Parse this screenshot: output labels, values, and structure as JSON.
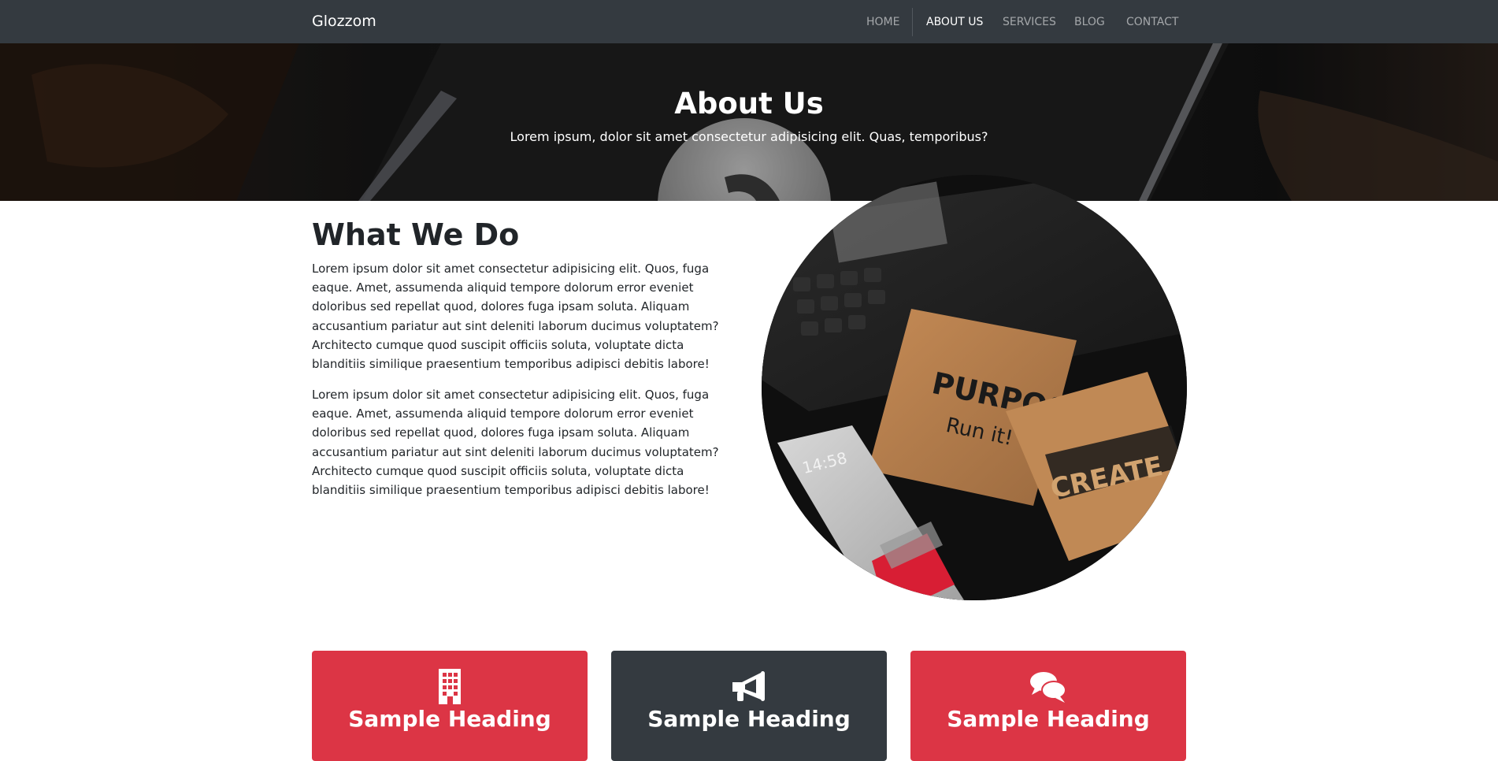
{
  "navbar": {
    "brand": "Glozzom",
    "links": [
      {
        "label": "HOME",
        "active": false
      },
      {
        "label": "ABOUT US",
        "active": true
      },
      {
        "label": "SERVICES",
        "active": false
      },
      {
        "label": "BLOG",
        "active": false
      },
      {
        "label": "CONTACT",
        "active": false
      }
    ]
  },
  "hero": {
    "title": "About Us",
    "subtitle": "Lorem ipsum, dolor sit amet consectetur adipisicing elit. Quas, temporibus?"
  },
  "about": {
    "heading": "What We Do",
    "paragraphs": [
      "Lorem ipsum dolor sit amet consectetur adipisicing elit. Quos, fuga eaque. Amet, assumenda aliquid tempore dolorum error eveniet doloribus sed repellat quod, dolores fuga ipsam soluta. Aliquam accusantium pariatur aut sint deleniti laborum ducimus voluptatem? Architecto cumque quod suscipit officiis soluta, voluptate dicta blanditiis similique praesentium temporibus adipisci debitis labore!",
      "Lorem ipsum dolor sit amet consectetur adipisicing elit. Quos, fuga eaque. Amet, assumenda aliquid tempore dolorum error eveniet doloribus sed repellat quod, dolores fuga ipsam soluta. Aliquam accusantium pariatur aut sint deleniti laborum ducimus voluptatem? Architecto cumque quod suscipit officiis soluta, voluptate dicta blanditiis similique praesentium temporibus adipisci debitis labore!"
    ],
    "photo_texts": [
      "PURPOSE",
      "Run it!",
      "CREATE",
      "14:58"
    ]
  },
  "cards": [
    {
      "heading": "Sample Heading",
      "icon": "building-icon",
      "color": "#dc3545"
    },
    {
      "heading": "Sample Heading",
      "icon": "bullhorn-icon",
      "color": "#343a40"
    },
    {
      "heading": "Sample Heading",
      "icon": "comments-icon",
      "color": "#dc3545"
    }
  ],
  "colors": {
    "navbar": "#343a40",
    "accent_red": "#dc3545",
    "dark": "#343a40"
  }
}
